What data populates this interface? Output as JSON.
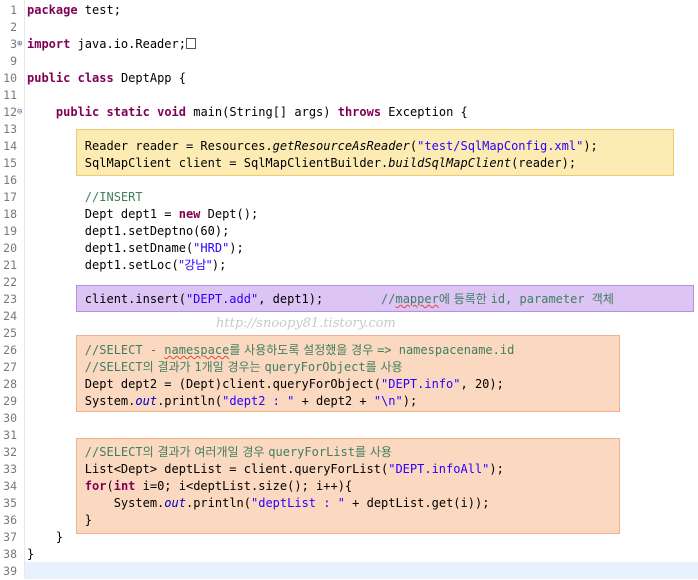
{
  "editor": {
    "lines": [
      {
        "n": "1",
        "tokens": [
          {
            "t": "package",
            "c": "kw"
          },
          {
            "t": " test;"
          }
        ]
      },
      {
        "n": "2",
        "tokens": []
      },
      {
        "n": "3",
        "fold": "+",
        "tokens": [
          {
            "t": "import",
            "c": "kw"
          },
          {
            "t": " java.io.Reader;"
          }
        ],
        "box": true
      },
      {
        "n": "9",
        "tokens": []
      },
      {
        "n": "10",
        "tokens": [
          {
            "t": "public",
            "c": "kw"
          },
          {
            "t": " "
          },
          {
            "t": "class",
            "c": "kw"
          },
          {
            "t": " DeptApp {"
          }
        ]
      },
      {
        "n": "11",
        "tokens": []
      },
      {
        "n": "12",
        "fold": "-",
        "tokens": [
          {
            "t": "    "
          },
          {
            "t": "public",
            "c": "kw"
          },
          {
            "t": " "
          },
          {
            "t": "static",
            "c": "kw"
          },
          {
            "t": " "
          },
          {
            "t": "void",
            "c": "kw"
          },
          {
            "t": " main(String[] args) "
          },
          {
            "t": "throws",
            "c": "kw"
          },
          {
            "t": " Exception {"
          }
        ]
      },
      {
        "n": "13",
        "tokens": []
      },
      {
        "n": "14",
        "tokens": [
          {
            "t": "        Reader reader = Resources."
          },
          {
            "t": "getResourceAsReader",
            "c": "ital"
          },
          {
            "t": "("
          },
          {
            "t": "\"test/SqlMapConfig.xml\"",
            "c": "str"
          },
          {
            "t": ");"
          }
        ]
      },
      {
        "n": "15",
        "tokens": [
          {
            "t": "        SqlMapClient client = SqlMapClientBuilder."
          },
          {
            "t": "buildSqlMapClient",
            "c": "ital"
          },
          {
            "t": "(reader);"
          }
        ]
      },
      {
        "n": "16",
        "tokens": []
      },
      {
        "n": "17",
        "tokens": [
          {
            "t": "        "
          },
          {
            "t": "//INSERT",
            "c": "cmt"
          }
        ]
      },
      {
        "n": "18",
        "tokens": [
          {
            "t": "        Dept dept1 = "
          },
          {
            "t": "new",
            "c": "kw"
          },
          {
            "t": " Dept();"
          }
        ]
      },
      {
        "n": "19",
        "tokens": [
          {
            "t": "        dept1.setDeptno(60);"
          }
        ]
      },
      {
        "n": "20",
        "tokens": [
          {
            "t": "        dept1.setDname("
          },
          {
            "t": "\"HRD\"",
            "c": "str"
          },
          {
            "t": ");"
          }
        ]
      },
      {
        "n": "21",
        "tokens": [
          {
            "t": "        dept1.setLoc("
          },
          {
            "t": "\"강남\"",
            "c": "str ko"
          },
          {
            "t": ");"
          }
        ]
      },
      {
        "n": "22",
        "tokens": []
      },
      {
        "n": "23",
        "tokens": [
          {
            "t": "        client.insert("
          },
          {
            "t": "\"DEPT.add\"",
            "c": "str"
          },
          {
            "t": ", dept1);        "
          },
          {
            "t": "//",
            "c": "cmt"
          },
          {
            "t": "mapper",
            "c": "cmt squig"
          },
          {
            "t": "에 등록한 ",
            "c": "cmt ko"
          },
          {
            "t": "id, parameter ",
            "c": "cmt"
          },
          {
            "t": "객체",
            "c": "cmt ko"
          }
        ]
      },
      {
        "n": "24",
        "tokens": []
      },
      {
        "n": "25",
        "tokens": []
      },
      {
        "n": "26",
        "tokens": [
          {
            "t": "        "
          },
          {
            "t": "//SELECT - ",
            "c": "cmt"
          },
          {
            "t": "namespace",
            "c": "cmt squig"
          },
          {
            "t": "를 사용하도록 설정했을 경우 ",
            "c": "cmt ko"
          },
          {
            "t": "=> namespacename.id",
            "c": "cmt"
          }
        ]
      },
      {
        "n": "27",
        "tokens": [
          {
            "t": "        "
          },
          {
            "t": "//SELECT",
            "c": "cmt"
          },
          {
            "t": "의 결과가 ",
            "c": "cmt ko"
          },
          {
            "t": "1",
            "c": "cmt"
          },
          {
            "t": "개일 경우는 ",
            "c": "cmt ko"
          },
          {
            "t": "queryForObject",
            "c": "cmt"
          },
          {
            "t": "를 사용",
            "c": "cmt ko"
          }
        ]
      },
      {
        "n": "28",
        "tokens": [
          {
            "t": "        Dept dept2 = (Dept)client.queryForObject("
          },
          {
            "t": "\"DEPT.info\"",
            "c": "str"
          },
          {
            "t": ", 20);"
          }
        ]
      },
      {
        "n": "29",
        "tokens": [
          {
            "t": "        System."
          },
          {
            "t": "out",
            "c": "fld"
          },
          {
            "t": ".println("
          },
          {
            "t": "\"dept2 : \"",
            "c": "str"
          },
          {
            "t": " + dept2 + "
          },
          {
            "t": "\"\\n\"",
            "c": "str"
          },
          {
            "t": ");"
          }
        ]
      },
      {
        "n": "30",
        "tokens": []
      },
      {
        "n": "31",
        "tokens": []
      },
      {
        "n": "32",
        "tokens": [
          {
            "t": "        "
          },
          {
            "t": "//SELECT",
            "c": "cmt"
          },
          {
            "t": "의 결과가 여러개일 경우 ",
            "c": "cmt ko"
          },
          {
            "t": "queryForList",
            "c": "cmt"
          },
          {
            "t": "를 사용",
            "c": "cmt ko"
          }
        ]
      },
      {
        "n": "33",
        "tokens": [
          {
            "t": "        List<Dept> deptList = client.queryForList("
          },
          {
            "t": "\"DEPT.infoAll\"",
            "c": "str"
          },
          {
            "t": ");"
          }
        ]
      },
      {
        "n": "34",
        "tokens": [
          {
            "t": "        "
          },
          {
            "t": "for",
            "c": "kw"
          },
          {
            "t": "("
          },
          {
            "t": "int",
            "c": "kw"
          },
          {
            "t": " i=0; i<deptList.size(); i++){"
          }
        ]
      },
      {
        "n": "35",
        "tokens": [
          {
            "t": "            System."
          },
          {
            "t": "out",
            "c": "fld"
          },
          {
            "t": ".println("
          },
          {
            "t": "\"deptList : \"",
            "c": "str"
          },
          {
            "t": " + deptList.get(i));"
          }
        ]
      },
      {
        "n": "36",
        "tokens": [
          {
            "t": "        }"
          }
        ]
      },
      {
        "n": "37",
        "tokens": [
          {
            "t": "    }"
          }
        ]
      },
      {
        "n": "38",
        "tokens": [
          {
            "t": "}"
          }
        ]
      },
      {
        "n": "39",
        "tokens": []
      }
    ]
  },
  "watermark": "http://snoopy81.tistory.com",
  "colors": {
    "keyword": "#7f0055",
    "string": "#2a00ff",
    "comment": "#3f7f5f",
    "highlight_yellow": "#fdebb4",
    "highlight_purple": "#dcc4f4",
    "highlight_orange": "#fbd8c0"
  }
}
